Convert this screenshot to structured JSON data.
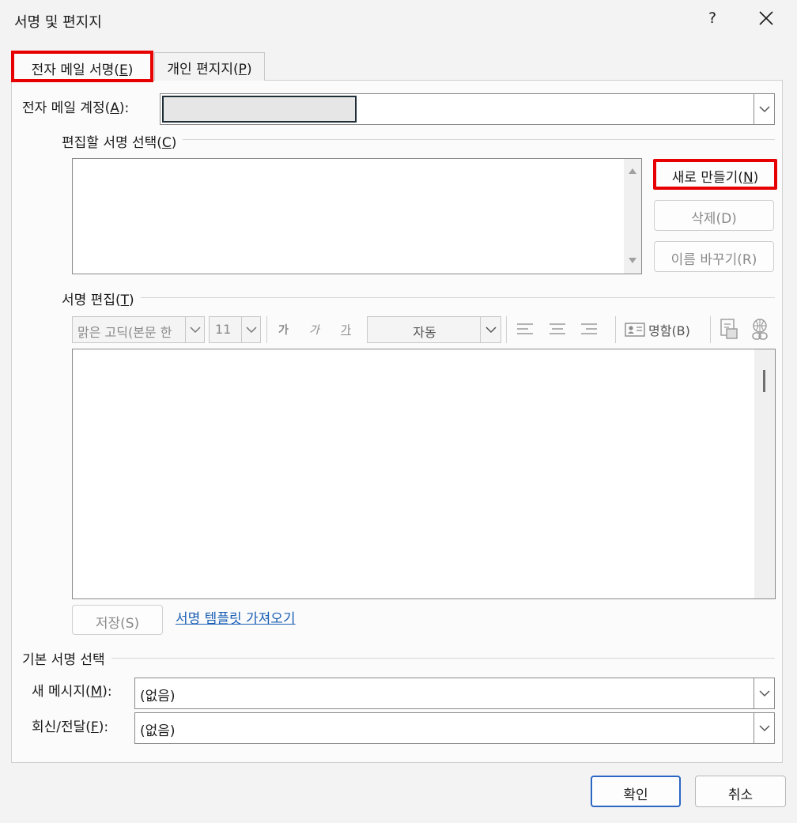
{
  "window": {
    "title": "서명 및 편지지",
    "help": "?"
  },
  "tabs": [
    {
      "label": "전자 메일 서명(",
      "key": "E",
      "suffix": ")"
    },
    {
      "label": "개인 편지지(",
      "key": "P",
      "suffix": ")"
    }
  ],
  "account": {
    "label": "전자 메일 계정(",
    "key": "A",
    "suffix": "):"
  },
  "select_sig": {
    "label": "편집할 서명 선택(",
    "key": "C",
    "suffix": ")"
  },
  "buttons": {
    "new": {
      "label": "새로 만들기(",
      "key": "N",
      "suffix": ")"
    },
    "delete": "삭제(D)",
    "rename": "이름 바꾸기(R)",
    "save": "저장(S)",
    "ok": "확인",
    "cancel": "취소"
  },
  "edit_sig": {
    "label": "서명 편집(",
    "key": "T",
    "suffix": ")"
  },
  "toolbar": {
    "font": "맑은 고딕(본문 한",
    "size": "11",
    "bold": "가",
    "italic": "가",
    "underline": "가",
    "color": "자동",
    "business_card": "명함(B)"
  },
  "template_link": "서명 템플릿 가져오기",
  "default_sig": {
    "label": "기본 서명 선택",
    "new_msg": {
      "label": "새 메시지(",
      "key": "M",
      "suffix": "):",
      "value": "(없음)"
    },
    "reply": {
      "label": "회신/전달(",
      "key": "F",
      "suffix": "):",
      "value": "(없음)"
    }
  },
  "colors": {
    "highlight": "#e60000",
    "link": "#1a5fb4",
    "ok_border": "#2b66c4"
  }
}
